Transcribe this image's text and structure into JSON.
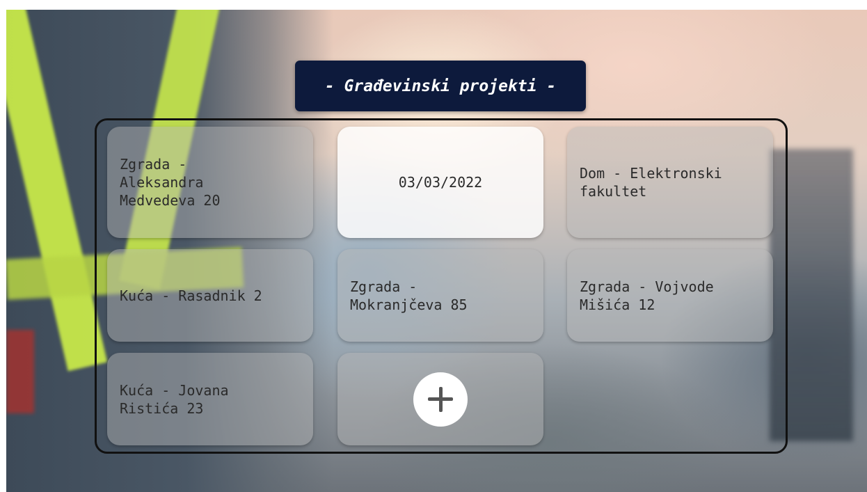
{
  "page": {
    "title": "- Građevinski projekti -"
  },
  "projects": [
    {
      "label": "Zgrada -\nAleksandra\nMedvedeva 20"
    },
    {
      "label": "03/03/2022"
    },
    {
      "label": "Dom - Elektronski\nfakultet"
    },
    {
      "label": "Kuća - Rasadnik 2"
    },
    {
      "label": "Zgrada -\nMokranjčeva 85"
    },
    {
      "label": "Zgrada - Vojvode\nMišića 12"
    },
    {
      "label": "Kuća - Jovana\nRistića 23"
    }
  ],
  "add_button": {
    "icon": "plus-icon"
  },
  "colors": {
    "title_bg": "#0d1a3c",
    "title_text": "#ffffff",
    "card_bg": "rgba(185,185,185,0.45)",
    "card_highlight_bg": "rgba(255,255,255,0.82)",
    "panel_border": "#111111"
  }
}
